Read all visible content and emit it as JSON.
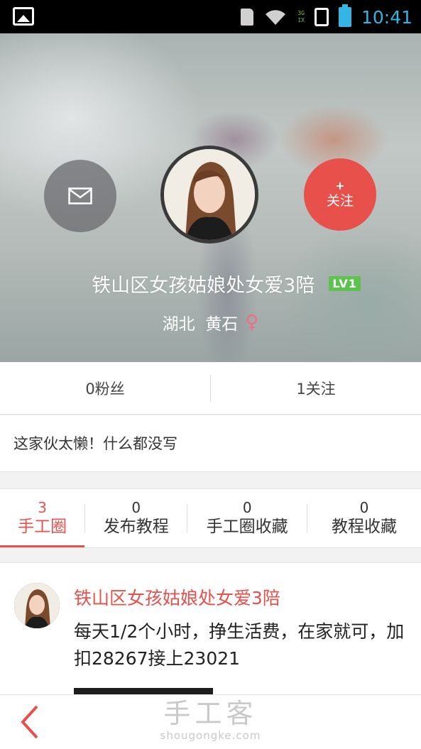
{
  "status_bar": {
    "time": "10:41",
    "signal_top": "3G",
    "signal_bottom": "IX",
    "icons": [
      "picture-icon",
      "sd-card-icon",
      "wifi-icon",
      "signal-icon",
      "phone-icon",
      "battery-charging-icon"
    ]
  },
  "profile": {
    "username": "铁山区女孩姑娘处女爱3陪",
    "level": "LV1",
    "location": "湖北  黄石",
    "gender_symbol": "♀",
    "follow_plus": "+",
    "follow_label": "关注"
  },
  "stats": {
    "fans": "0粉丝",
    "following": "1关注"
  },
  "bio": "这家伙太懒！什么都没写",
  "tabs": [
    {
      "count": "3",
      "label": "手工圈"
    },
    {
      "count": "0",
      "label": "发布教程"
    },
    {
      "count": "0",
      "label": "手工圈收藏"
    },
    {
      "count": "0",
      "label": "教程收藏"
    }
  ],
  "post": {
    "author": "铁山区女孩姑娘处女爱3陪",
    "text": "每天1/2个小时，挣生活费，在家就可，加扣28267接上23021"
  },
  "brand": {
    "name_cn": "手工客",
    "name_en": "shougongke.com"
  },
  "colors": {
    "accent": "#e8504c",
    "level_badge": "#5ec24f",
    "gender": "#ef6f87",
    "status_blue": "#35b5e5"
  }
}
